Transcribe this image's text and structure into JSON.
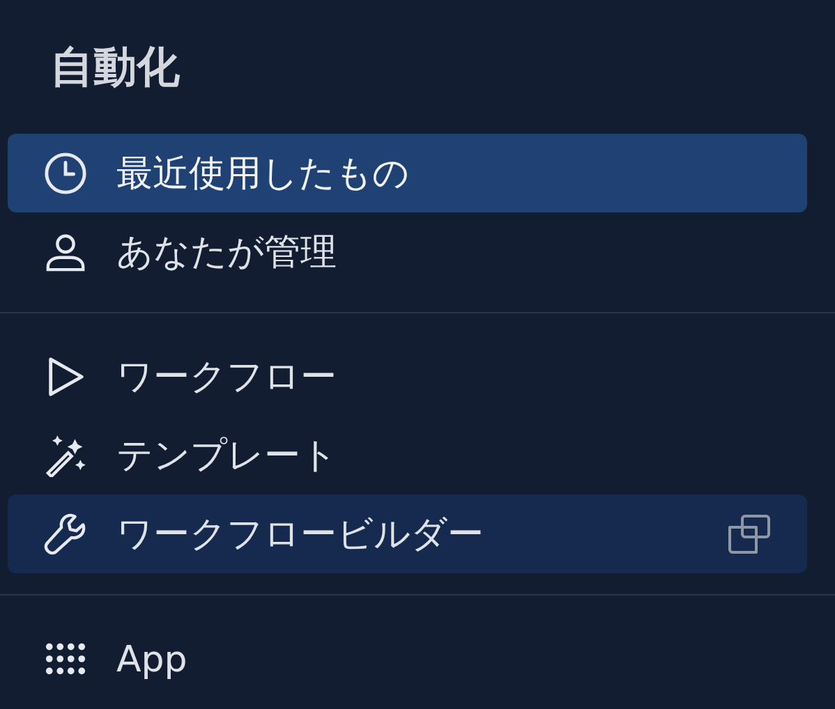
{
  "title": "自動化",
  "sections": [
    {
      "items": [
        {
          "label": "最近使用したもの",
          "selected": true,
          "hovered": false,
          "external": false
        },
        {
          "label": "あなたが管理",
          "selected": false,
          "hovered": false,
          "external": false
        }
      ]
    },
    {
      "items": [
        {
          "label": "ワークフロー",
          "selected": false,
          "hovered": false,
          "external": false
        },
        {
          "label": "テンプレート",
          "selected": false,
          "hovered": false,
          "external": false
        },
        {
          "label": "ワークフロービルダー",
          "selected": false,
          "hovered": true,
          "external": true
        }
      ]
    },
    {
      "items": [
        {
          "label": "App",
          "selected": false,
          "hovered": false,
          "external": false
        }
      ]
    }
  ]
}
